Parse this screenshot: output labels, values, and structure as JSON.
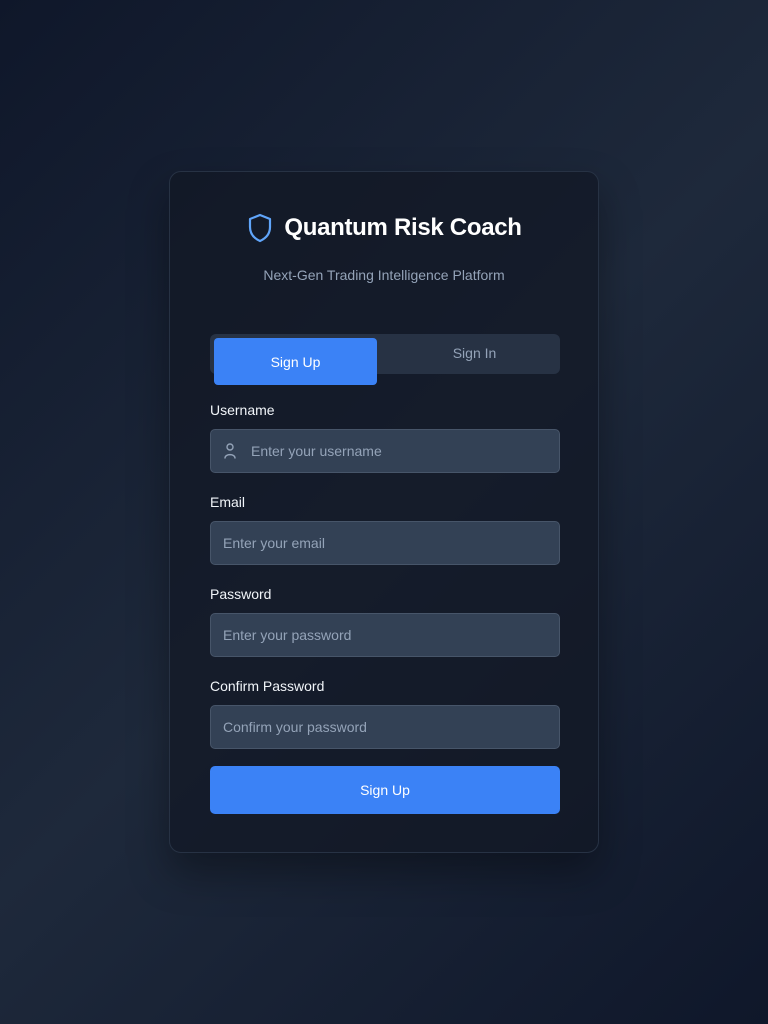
{
  "app": {
    "title": "Quantum Risk Coach",
    "subtitle": "Next-Gen Trading Intelligence Platform",
    "logo_icon": "shield-icon",
    "accent_color": "#3b82f6"
  },
  "tabs": {
    "active": "Sign Up",
    "sign_up_label": "Sign Up",
    "sign_in_label": "Sign In"
  },
  "form": {
    "username": {
      "label": "Username",
      "placeholder": "Enter your username",
      "value": "",
      "icon": "user-icon"
    },
    "email": {
      "label": "Email",
      "placeholder": "Enter your email",
      "value": ""
    },
    "password": {
      "label": "Password",
      "placeholder": "Enter your password",
      "value": ""
    },
    "confirm_password": {
      "label": "Confirm Password",
      "placeholder": "Confirm your password",
      "value": ""
    },
    "submit_label": "Sign Up"
  }
}
